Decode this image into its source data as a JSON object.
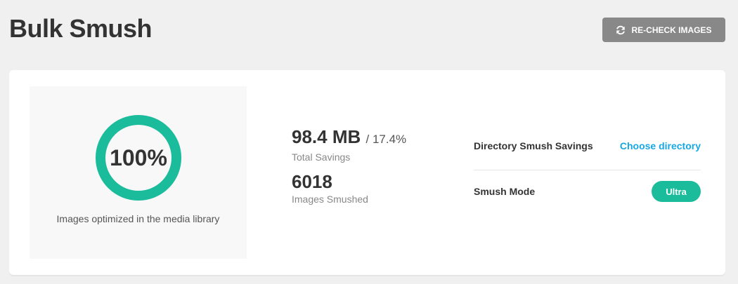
{
  "header": {
    "title": "Bulk Smush",
    "recheck_label": "RE-CHECK IMAGES",
    "recheck_icon": "refresh-icon"
  },
  "score": {
    "percent_text": "100%",
    "percent_value": 100,
    "caption": "Images optimized in the media library",
    "ring_color": "#1abc9c"
  },
  "stats": {
    "savings_value": "98.4 MB",
    "savings_percent": "/ 17.4%",
    "savings_label": "Total Savings",
    "smushed_value": "6018",
    "smushed_label": "Images Smushed"
  },
  "directory": {
    "label": "Directory Smush Savings",
    "link_text": "Choose directory",
    "link_color": "#17a8e3"
  },
  "mode": {
    "label": "Smush Mode",
    "badge": "Ultra",
    "badge_color": "#1abc9c"
  }
}
